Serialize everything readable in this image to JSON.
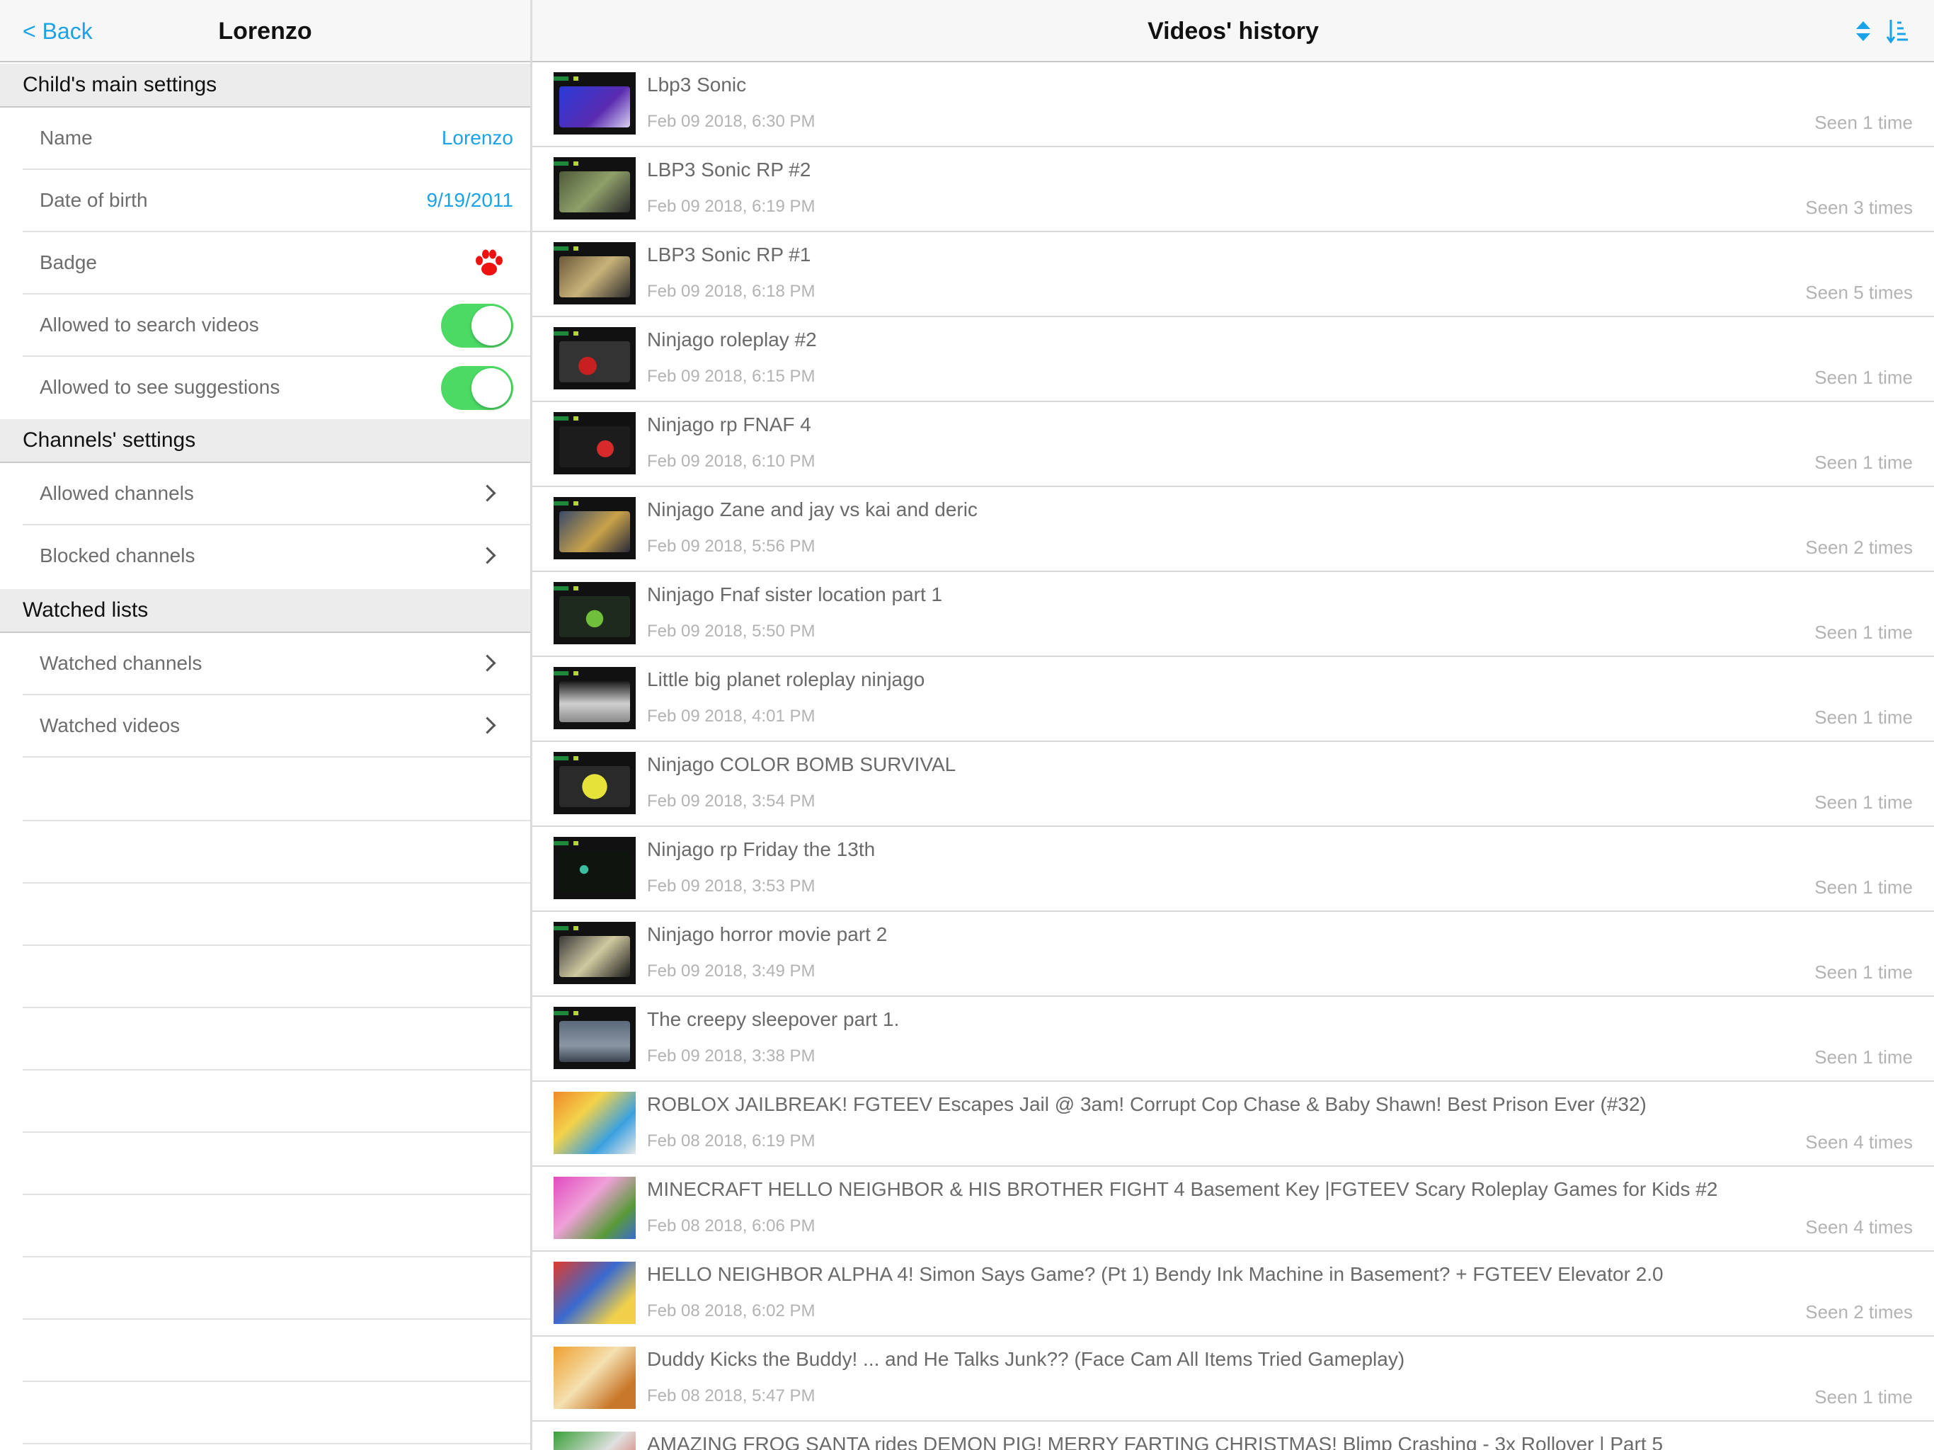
{
  "left": {
    "back_label": "< Back",
    "title": "Lorenzo",
    "sections": [
      {
        "header": "Child's main settings",
        "rows": [
          {
            "label": "Name",
            "value": "Lorenzo",
            "kind": "value"
          },
          {
            "label": "Date of birth",
            "value": "9/19/2011",
            "kind": "value"
          },
          {
            "label": "Badge",
            "icon": "paw-icon",
            "kind": "icon"
          },
          {
            "label": "Allowed to search videos",
            "on": true,
            "kind": "toggle"
          },
          {
            "label": "Allowed to see suggestions",
            "on": true,
            "kind": "toggle"
          }
        ]
      },
      {
        "header": "Channels' settings",
        "rows": [
          {
            "label": "Allowed channels",
            "kind": "disclosure"
          },
          {
            "label": "Blocked channels",
            "kind": "disclosure"
          }
        ]
      },
      {
        "header": "Watched lists",
        "rows": [
          {
            "label": "Watched channels",
            "kind": "disclosure"
          },
          {
            "label": "Watched videos",
            "kind": "disclosure"
          }
        ]
      }
    ]
  },
  "right": {
    "title": "Videos' history",
    "sort_toggle_icon": "sort-arrows-icon",
    "sort_order_icon": "sort-descending-icon",
    "videos": [
      {
        "title": "Lbp3 Sonic",
        "date": "Feb 09 2018, 6:30 PM",
        "seen": "Seen 1 time"
      },
      {
        "title": "LBP3 Sonic RP #2",
        "date": "Feb 09 2018, 6:19 PM",
        "seen": "Seen 3 times"
      },
      {
        "title": "LBP3 Sonic RP #1",
        "date": "Feb 09 2018, 6:18 PM",
        "seen": "Seen 5 times"
      },
      {
        "title": "Ninjago roleplay #2",
        "date": "Feb 09 2018, 6:15 PM",
        "seen": "Seen 1 time"
      },
      {
        "title": "Ninjago rp FNAF 4",
        "date": "Feb 09 2018, 6:10 PM",
        "seen": "Seen 1 time"
      },
      {
        "title": "Ninjago Zane and jay vs kai and deric",
        "date": "Feb 09 2018, 5:56 PM",
        "seen": "Seen 2 times"
      },
      {
        "title": "Ninjago Fnaf sister location part 1",
        "date": "Feb 09 2018, 5:50 PM",
        "seen": "Seen 1 time"
      },
      {
        "title": "Little big planet roleplay ninjago",
        "date": "Feb 09 2018, 4:01 PM",
        "seen": "Seen 1 time"
      },
      {
        "title": "Ninjago COLOR BOMB SURVIVAL",
        "date": "Feb 09 2018, 3:54 PM",
        "seen": "Seen 1 time"
      },
      {
        "title": "Ninjago rp Friday the 13th",
        "date": "Feb 09 2018, 3:53 PM",
        "seen": "Seen 1 time"
      },
      {
        "title": "Ninjago horror movie part 2",
        "date": "Feb 09 2018, 3:49 PM",
        "seen": "Seen 1 time"
      },
      {
        "title": "The creepy sleepover part 1.",
        "date": "Feb 09 2018, 3:38 PM",
        "seen": "Seen 1 time"
      },
      {
        "title": "ROBLOX JAILBREAK! FGTEEV Escapes Jail @ 3am! Corrupt Cop Chase & Baby Shawn! Best Prison Ever (#32)",
        "date": "Feb 08 2018, 6:19 PM",
        "seen": "Seen 4 times"
      },
      {
        "title": "MINECRAFT HELLO NEIGHBOR & HIS BROTHER FIGHT 4 Basement Key |FGTEEV Scary Roleplay Games for Kids #2",
        "date": "Feb 08 2018, 6:06 PM",
        "seen": "Seen 4 times"
      },
      {
        "title": "HELLO NEIGHBOR ALPHA 4! Simon Says Game? (Pt 1) Bendy Ink Machine in Basement? + FGTEEV Elevator 2.0",
        "date": "Feb 08 2018, 6:02 PM",
        "seen": "Seen 2 times"
      },
      {
        "title": "Duddy Kicks the Buddy! ... and He Talks Junk?? (Face Cam All Items Tried Gameplay)",
        "date": "Feb 08 2018, 5:47 PM",
        "seen": "Seen 1 time"
      },
      {
        "title": "AMAZING FROG SANTA rides DEMON PIG! MERRY FARTING CHRISTMAS! Blimp Crashing - 3x Rollover | Part 5",
        "date": "",
        "seen": ""
      }
    ]
  },
  "colors": {
    "accent": "#1aa3e8",
    "toggle_on": "#4cd964",
    "badge_paw": "#ee1111"
  }
}
